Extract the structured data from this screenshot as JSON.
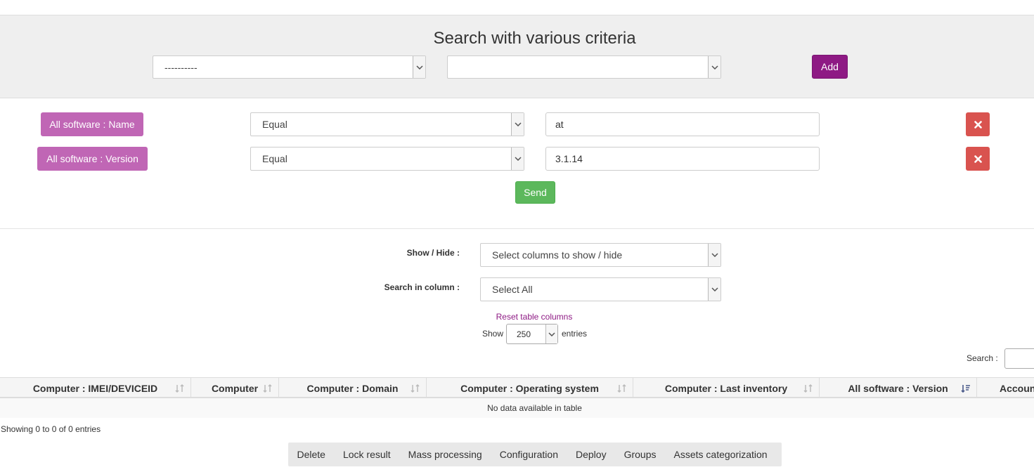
{
  "criteria": {
    "title": "Search with various criteria",
    "field_select_value": "----------",
    "operator_select_value": "",
    "add_label": "Add"
  },
  "conditions": [
    {
      "label": "All software : Name",
      "operator": "Equal",
      "value": "at"
    },
    {
      "label": "All software : Version",
      "operator": "Equal",
      "value": "3.1.14"
    }
  ],
  "send_label": "Send",
  "table_controls": {
    "show_hide_label": "Show / Hide :",
    "show_hide_value": "Select columns to show / hide",
    "search_in_column_label": "Search in column :",
    "search_in_column_value": "Select All",
    "reset_link": "Reset table columns",
    "show_label": "Show",
    "length_value": "250",
    "entries_label": "entries",
    "search_label": "Search :"
  },
  "table": {
    "columns": [
      "Computer : IMEI/DEVICEID",
      "Computer",
      "Computer : Domain",
      "Computer : Operating system",
      "Computer : Last inventory",
      "All software : Version",
      "Account"
    ],
    "empty_message": "No data available in table",
    "info": "Showing 0 to 0 of 0 entries"
  },
  "actions": [
    "Delete",
    "Lock result",
    "Mass processing",
    "Configuration",
    "Deploy",
    "Groups",
    "Assets categorization"
  ],
  "colors": {
    "accent": "#8e1a84",
    "tag": "#c066b5",
    "danger": "#d9534f",
    "success": "#5cb85c"
  }
}
